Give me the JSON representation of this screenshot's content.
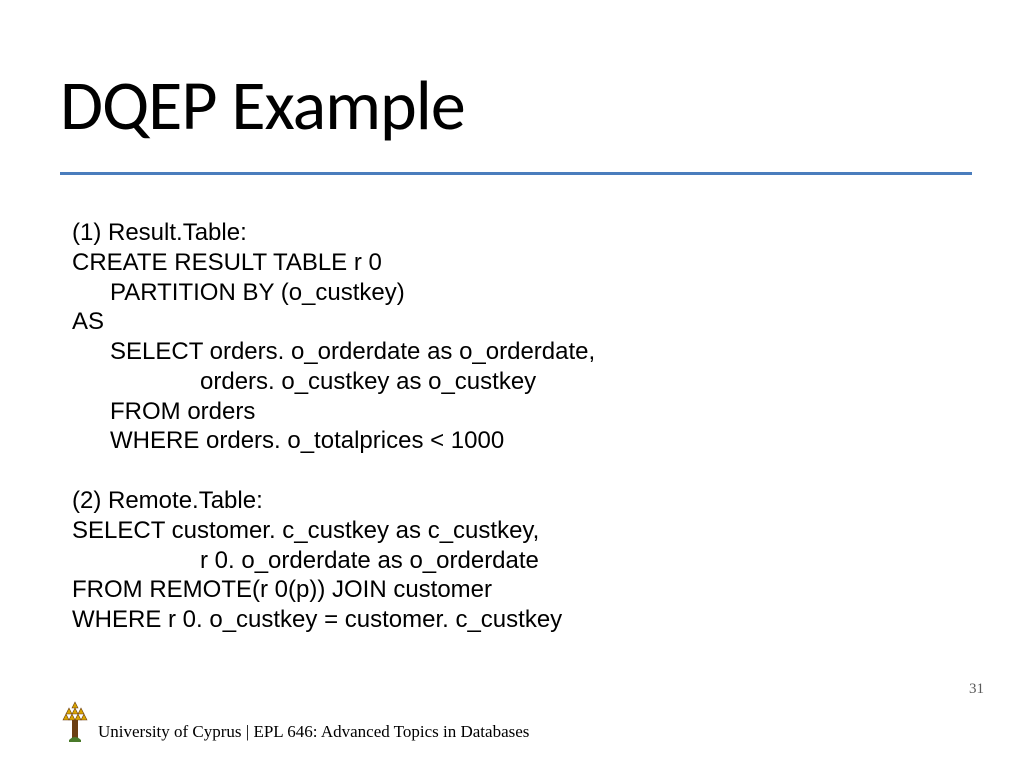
{
  "title": "DQEP Example",
  "block1": {
    "l1": "(1) Result.Table:",
    "l2": "CREATE RESULT TABLE r 0",
    "l3": "PARTITION BY (o_custkey)",
    "l4": "AS",
    "l5": "SELECT orders. o_orderdate as o_orderdate,",
    "l6": "orders. o_custkey as o_custkey",
    "l7": "FROM orders",
    "l8": "WHERE orders. o_totalprices < 1000"
  },
  "block2": {
    "l1": "(2) Remote.Table:",
    "l2": "SELECT customer. c_custkey as c_custkey,",
    "l3": "r 0. o_orderdate as o_orderdate",
    "l4": "FROM REMOTE(r 0(p)) JOIN customer",
    "l5": "WHERE r 0. o_custkey = customer. c_custkey"
  },
  "footer": "University of Cyprus | EPL 646: Advanced Topics in Databases",
  "pagenum": "31",
  "logo_name": "university-logo",
  "colors": {
    "rule": "#4a7dbd",
    "logo_yellow": "#d9a400",
    "logo_brown": "#6b3f12"
  }
}
